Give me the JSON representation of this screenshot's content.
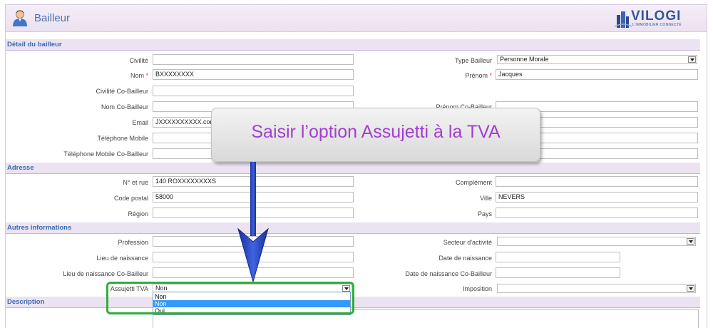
{
  "header": {
    "title": "Bailleur",
    "logo_text": "VILOGI",
    "logo_sub": "L'IMMOBILIER CONNECTÉ"
  },
  "sections": {
    "detail": "Détail du bailleur",
    "adresse": "Adresse",
    "autres": "Autres informations",
    "description": "Description"
  },
  "detail": {
    "civilite": {
      "label": "Civilité",
      "value": ""
    },
    "type_bailleur": {
      "label": "Type Bailleur",
      "value": "Personne Morale"
    },
    "nom": {
      "label": "Nom",
      "value": "BXXXXXXXX"
    },
    "prenom": {
      "label": "Prénom",
      "value": "Jacques"
    },
    "civilite_co": {
      "label": "Civilité Co-Bailleur",
      "value": ""
    },
    "nom_co": {
      "label": "Nom Co-Bailleur",
      "value": ""
    },
    "prenom_co": {
      "label": "Prénom Co-Bailleur",
      "value": ""
    },
    "email": {
      "label": "Email",
      "value": "JXXXXXXXXXX.com"
    },
    "tel_mobile": {
      "label": "Téléphone Mobile",
      "value": ""
    },
    "tel_mobile_co": {
      "label": "Téléphone Mobile Co-Bailleur",
      "value": ""
    }
  },
  "adresse": {
    "rue": {
      "label": "N° et rue",
      "value": "140 ROXXXXXXXXS"
    },
    "complement": {
      "label": "Complément",
      "value": ""
    },
    "code_postal": {
      "label": "Code postal",
      "value": "58000"
    },
    "ville": {
      "label": "Ville",
      "value": "NEVERS"
    },
    "region": {
      "label": "Région",
      "value": ""
    },
    "pays": {
      "label": "Pays",
      "value": ""
    }
  },
  "autres": {
    "profession": {
      "label": "Profession",
      "value": ""
    },
    "secteur": {
      "label": "Secteur d'activité",
      "value": ""
    },
    "lieu_naissance": {
      "label": "Lieu de naissance",
      "value": ""
    },
    "date_naissance": {
      "label": "Date de naissance",
      "value": ""
    },
    "lieu_naissance_co": {
      "label": "Lieu de naissance Co-Bailleur",
      "value": ""
    },
    "date_naissance_co": {
      "label": "Date de naissance Co-Bailleur",
      "value": ""
    },
    "assujetti": {
      "label": "Assujetti TVA",
      "value": "Non",
      "options": [
        "Non",
        "Non",
        "Oui"
      ],
      "highlighted_index": 1
    },
    "imposition": {
      "label": "Imposition",
      "value": ""
    }
  },
  "description": {
    "label": "Description"
  },
  "callout": {
    "text": "Saisir l’option Assujetti à la TVA"
  },
  "colors": {
    "accent": "#3a6ab0",
    "callout_text": "#a23fcf",
    "highlight_border": "#2fae3b",
    "arrow": "#2a47c8"
  },
  "icons": {
    "avatar": "user-avatar-icon",
    "logo": "building-logo-icon"
  }
}
